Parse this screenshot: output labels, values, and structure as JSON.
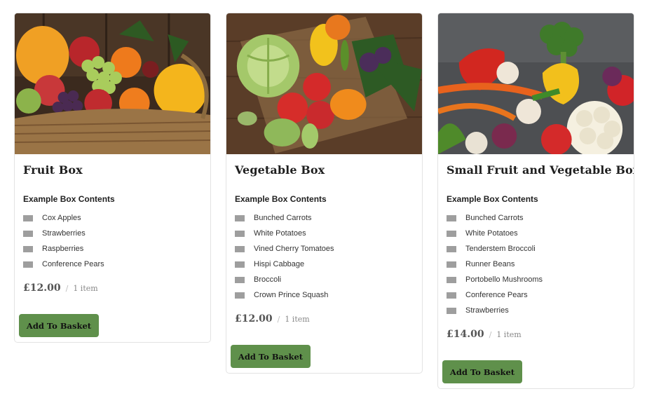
{
  "products": [
    {
      "title": "Fruit Box",
      "contents_heading": "Example Box Contents",
      "items": [
        "Cox Apples",
        "Strawberries",
        "Raspberries",
        "Conference Pears"
      ],
      "price": "£12.00",
      "separator": "/",
      "quantity": "1 item",
      "button_label": "Add To Basket",
      "image": "fruit-basket-photo"
    },
    {
      "title": "Vegetable Box",
      "contents_heading": "Example Box Contents",
      "items": [
        "Bunched Carrots",
        "White Potatoes",
        "Vined Cherry Tomatoes",
        "Hispi Cabbage",
        "Broccoli",
        "Crown Prince Squash"
      ],
      "price": "£12.00",
      "separator": "/",
      "quantity": "1 item",
      "button_label": "Add To Basket",
      "image": "vegetable-basket-photo"
    },
    {
      "title": "Small Fruit and Vegetable Box",
      "contents_heading": "Example Box Contents",
      "items": [
        "Bunched Carrots",
        "White Potatoes",
        "Tenderstem Broccoli",
        "Runner Beans",
        "Portobello Mushrooms",
        "Conference Pears",
        "Strawberries"
      ],
      "price": "£14.00",
      "separator": "/",
      "quantity": "1 item",
      "button_label": "Add To Basket",
      "image": "mixed-produce-photo"
    }
  ],
  "colors": {
    "button": "#5f904b",
    "bullet": "#9e9e9e",
    "card_border": "#e3e3e3",
    "price": "#555555"
  }
}
